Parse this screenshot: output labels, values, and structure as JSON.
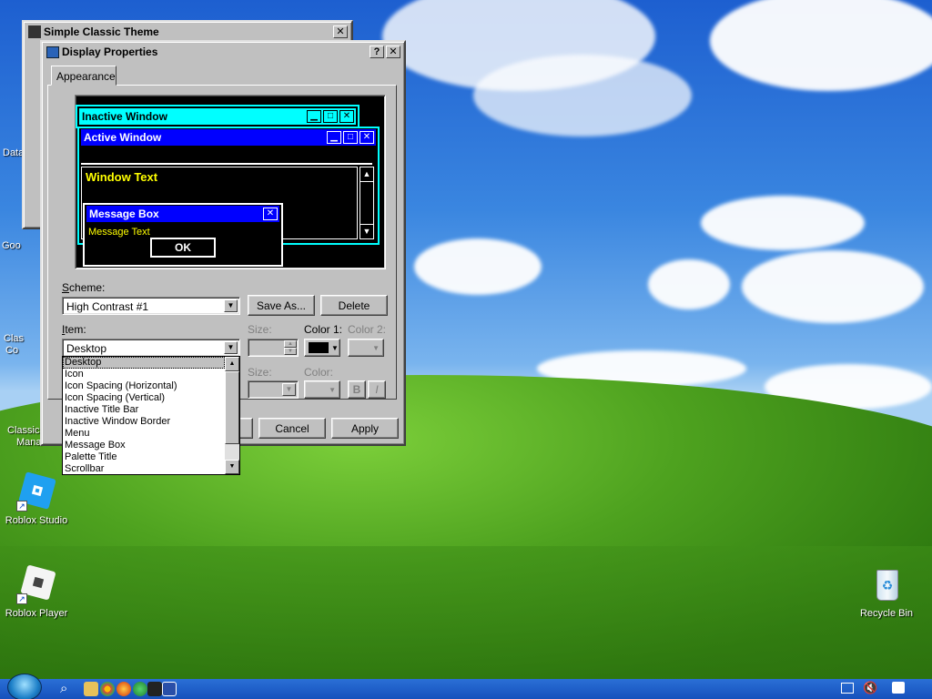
{
  "desktop": {
    "icons": [
      {
        "label": "Roblox Studio"
      },
      {
        "label": "Roblox Player"
      },
      {
        "label": "Recycle Bin"
      }
    ],
    "partial_labels": [
      "Data",
      "Goo",
      "Clas",
      "Co",
      "Classic",
      "Mana"
    ]
  },
  "back_window": {
    "title": "Simple Classic Theme",
    "close": "✕"
  },
  "dialog": {
    "title": "Display Properties",
    "help": "?",
    "close": "✕",
    "tab": "Appearance",
    "preview": {
      "inactive_title": "Inactive Window",
      "active_title": "Active Window",
      "window_text": "Window Text",
      "message_box_title": "Message Box",
      "message_text": "Message Text",
      "ok": "OK"
    },
    "scheme_label": "Scheme:",
    "scheme_value": "High Contrast #1",
    "save_as": "Save As...",
    "delete": "Delete",
    "item_label": "Item:",
    "item_value": "Desktop",
    "size_label": "Size:",
    "color1_label": "Color 1:",
    "color2_label": "Color 2:",
    "font_size_label": "Size:",
    "font_color_label": "Color:",
    "bold": "B",
    "italic": "I",
    "cancel": "Cancel",
    "apply": "Apply",
    "item_options": [
      "Desktop",
      "Icon",
      "Icon Spacing (Horizontal)",
      "Icon Spacing (Vertical)",
      "Inactive Title Bar",
      "Inactive Window Border",
      "Menu",
      "Message Box",
      "Palette Title",
      "Scrollbar"
    ]
  },
  "colors": {
    "inactive_title_bg": "#00ffff",
    "active_title_bg": "#0000ff",
    "window_text": "#ffff00",
    "selection": "#c0c0c0",
    "taskbar": "#1d5fc8"
  }
}
